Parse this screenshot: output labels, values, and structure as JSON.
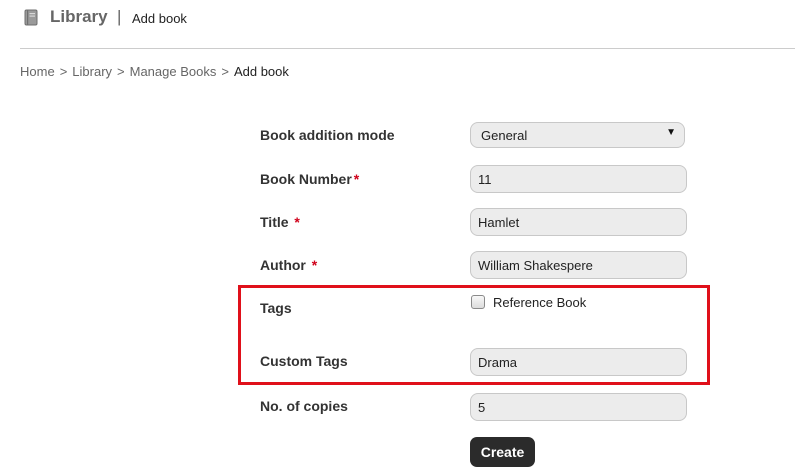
{
  "header": {
    "app_icon": "book-icon",
    "app_title": "Library",
    "separator": "|",
    "page_subtitle": "Add book"
  },
  "breadcrumb": {
    "items": [
      "Home",
      "Library",
      "Manage Books"
    ],
    "current": "Add book",
    "separator": ">"
  },
  "form": {
    "mode": {
      "label": "Book addition mode",
      "value": "General"
    },
    "book_number": {
      "label": "Book Number",
      "required": "*",
      "value": "11"
    },
    "title": {
      "label": "Title ",
      "required": "*",
      "value": "Hamlet"
    },
    "author": {
      "label": "Author ",
      "required": "*",
      "value": "William Shakespere"
    },
    "tags": {
      "label": "Tags",
      "option_label": "Reference Book",
      "checked": false
    },
    "custom_tags": {
      "label": "Custom Tags",
      "value": "Drama"
    },
    "copies": {
      "label": "No. of copies",
      "value": "5"
    },
    "submit_label": "Create"
  },
  "colors": {
    "highlight": "#e0101a",
    "required": "#d0021b",
    "button": "#2b2b2b"
  }
}
